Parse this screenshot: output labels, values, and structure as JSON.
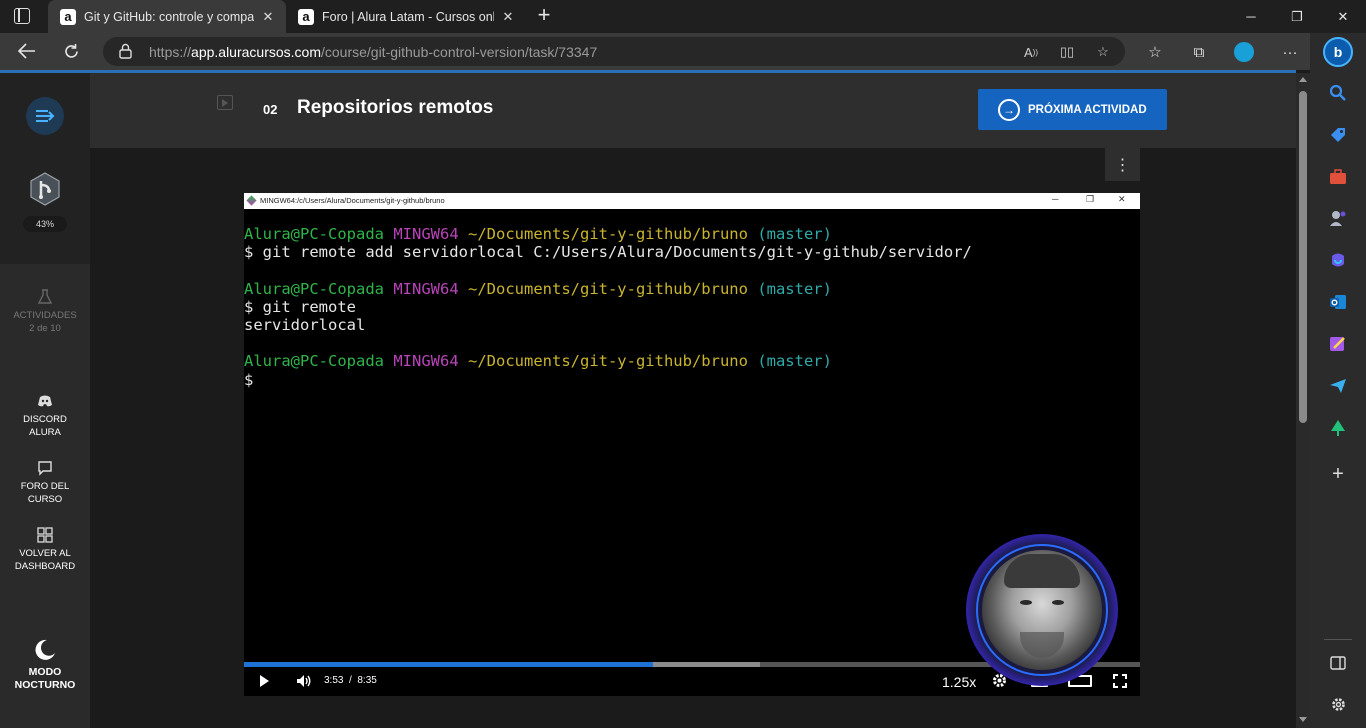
{
  "browser": {
    "tabs": [
      {
        "title": "Git y GitHub: controle y compartir",
        "favicon": "a",
        "active": true
      },
      {
        "title": "Foro | Alura Latam - Cursos online",
        "favicon": "a",
        "active": false
      }
    ],
    "url": {
      "scheme": "https://",
      "host": "app.aluracursos.com",
      "path": "/course/git-github-control-version/task/73347"
    },
    "accent_color": "#2b6fb8"
  },
  "sidebar": {
    "progress": "43%",
    "activities_label": "ACTIVIDADES",
    "activities_count": "2 de 10",
    "discord_label_1": "DISCORD",
    "discord_label_2": "ALURA",
    "foro_label_1": "FORO DEL",
    "foro_label_2": "CURSO",
    "dashboard_label_1": "VOLVER AL",
    "dashboard_label_2": "DASHBOARD",
    "night_label_1": "MODO",
    "night_label_2": "NOCTURNO"
  },
  "header": {
    "activity_number": "02",
    "activity_title": "Repositorios remotos",
    "next_button": "PRÓXIMA ACTIVIDAD",
    "next_button_color": "#1565c0"
  },
  "video": {
    "terminal_title": "MINGW64:/c/Users/Alura/Documents/git-y-github/bruno",
    "prompt_user": "Alura@PC-Copada",
    "prompt_env": "MINGW64",
    "prompt_path": "~/Documents/git-y-github/bruno",
    "prompt_branch": "(master)",
    "cmd1": "$ git remote add servidorlocal C:/Users/Alura/Documents/git-y-github/servidor/",
    "cmd2": "$ git remote",
    "output2": "servidorlocal",
    "cmd3": "$",
    "current_time": "3:53",
    "time_separator": "/",
    "duration": "8:35",
    "played_fraction": 0.456,
    "buffered_fraction": 0.576,
    "speed": "1.25x"
  }
}
